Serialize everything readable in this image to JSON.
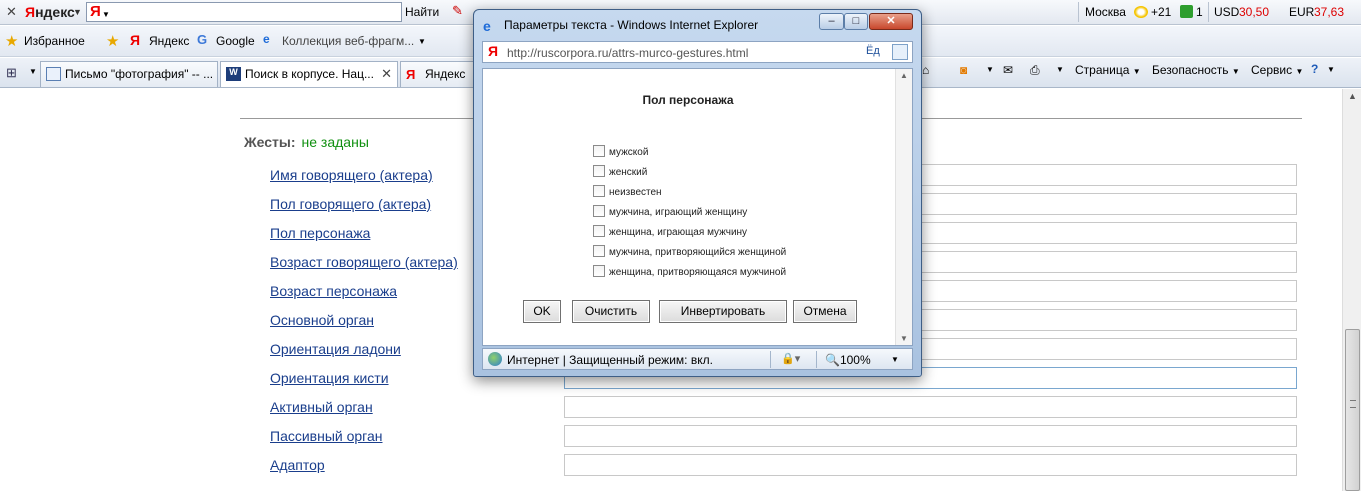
{
  "yandex_bar": {
    "brand": "Яндекс",
    "search_value": "",
    "find_label": "Найти",
    "city": "Москва",
    "temperature": "+21",
    "mail_count": "1",
    "usd_label": "USD",
    "usd_value": "30,50",
    "eur_label": "EUR",
    "eur_value": "37,63"
  },
  "favorites_bar": {
    "favorites_label": "Избранное",
    "items": [
      "Яндекс",
      "Google",
      "Коллекция веб-фрагм..."
    ]
  },
  "tabs": [
    {
      "title": "Письмо \"фотография\" -- ...",
      "icon": "mail-icon"
    },
    {
      "title": "Поиск в корпусе. Нац...",
      "icon": "ruscorpora-icon"
    },
    {
      "title": "Яндекс",
      "icon": "yandex-icon"
    }
  ],
  "command_bar": {
    "page": "Страница",
    "safety": "Безопасность",
    "service": "Сервис"
  },
  "page": {
    "gestures_label": "Жесты:",
    "gestures_value": "не заданы",
    "fields": [
      "Имя говорящего (актера)",
      "Пол говорящего (актера)",
      "Пол персонажа",
      "Возраст говорящего (актера)",
      "Возраст персонажа",
      "Основной орган",
      "Ориентация ладони",
      "Ориентация кисти",
      "Активный орган",
      "Пассивный орган",
      "Адаптор"
    ]
  },
  "popup": {
    "window_title": "Параметры текста - Windows Internet Explorer",
    "url": "http://ruscorpora.ru/attrs-murco-gestures.html",
    "heading": "Пол персонажа",
    "options": [
      {
        "label": "мужской",
        "checked": false
      },
      {
        "label": "женский",
        "checked": false
      },
      {
        "label": "неизвестен",
        "checked": false
      },
      {
        "label": "мужчина, играющий женщину",
        "checked": false
      },
      {
        "label": "женщина, играющая мужчину",
        "checked": false
      },
      {
        "label": "мужчина, притворяющийся женщиной",
        "checked": false
      },
      {
        "label": "женщина, притворяющаяся мужчиной",
        "checked": false
      }
    ],
    "buttons": {
      "ok": "OK",
      "clear": "Очистить",
      "invert": "Инвертировать",
      "cancel": "Отмена"
    },
    "status_text": "Интернет | Защищенный режим: вкл.",
    "zoom": "100%"
  }
}
